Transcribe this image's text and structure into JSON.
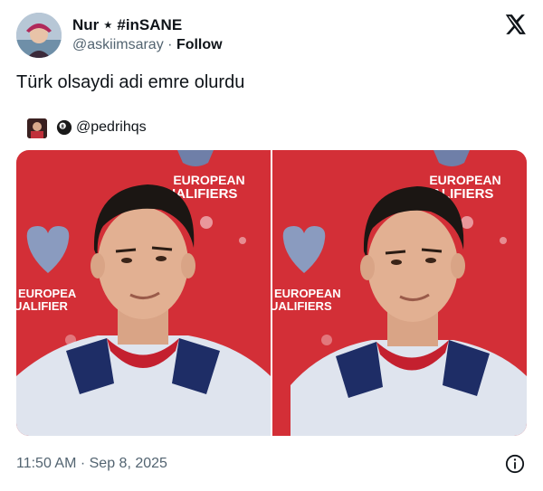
{
  "author": {
    "display_name": "Nur ⋆ #inSANE",
    "handle": "@askiimsaray",
    "separator": "·",
    "follow_label": "Follow"
  },
  "tweet_text": "Türk olsaydi adi emre olurdu",
  "quoted": {
    "handle": "@pedrihqs",
    "badge_icon": "8-ball-icon"
  },
  "photos": {
    "left": {
      "banner_line1": "EUROPEAN",
      "banner_line2": "QUALIFIERS",
      "side_line1": "EUROPEA",
      "side_line2": "UALIFIER"
    },
    "right": {
      "banner_line1": "EUROPEAN",
      "banner_line2": "QUALIFIERS",
      "side_line1": "EUROPEAN",
      "side_line2": "UALIFIERS"
    }
  },
  "footer": {
    "timestamp": "11:50 AM · Sep 8, 2025"
  },
  "icons": {
    "brand": "x-logo-icon",
    "info": "info-icon"
  },
  "colors": {
    "text_primary": "#0f1419",
    "text_secondary": "#536471",
    "backdrop_red": "#d9323a"
  }
}
